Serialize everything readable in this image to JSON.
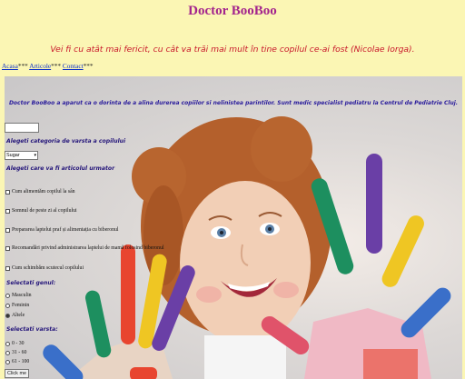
{
  "header": {
    "title": "Doctor BooBoo",
    "quote": "Vei fi cu atât mai fericit, cu cât va trăi mai mult în tine copilul ce-ai fost (Nicolae Iorga)."
  },
  "nav": {
    "items": [
      {
        "label": "Acasa",
        "sep": "***"
      },
      {
        "label": "Articole",
        "sep": "***"
      },
      {
        "label": "Contact",
        "sep": "***"
      }
    ]
  },
  "intro": "Doctor BooBoo a aparut ca o dorinta de a alina durerea copiilor si nelinistea parintilor. Sunt medic specialist pediatru la Centrul de Pediatrie Cluj.",
  "search": {
    "value": ""
  },
  "age_category": {
    "label": "Alegeti categoria de varsta a copilului",
    "selected": "Sugar"
  },
  "next_article": {
    "label": "Alegeti care va fi articolul urmator",
    "options": [
      "Cum alimentăm copilul la sân",
      "Somnul de peste zi al copilului",
      "Prepararea laptelui praf și alimentația cu biberonul",
      "Recomandări privind administrarea laptelui de mamă folosind biberonul",
      "Cum schimbăm scutecul copilului"
    ]
  },
  "gender": {
    "label": "Selectati genul:",
    "options": [
      "Masculin",
      "Feminin",
      "Altele"
    ],
    "selected_index": 2
  },
  "age": {
    "label": "Selectati varsta:",
    "options": [
      "0 - 30",
      "31 - 60",
      "61 - 100"
    ],
    "selected_index": -1
  },
  "submit_label": "Click me",
  "colors": {
    "page_bg": "#fbf6b4",
    "title": "#a3248d",
    "quote": "#c8162a",
    "link": "#0b2fc8",
    "form_label": "#24157a"
  }
}
